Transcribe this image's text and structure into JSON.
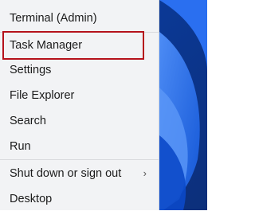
{
  "menu": {
    "items": [
      {
        "label": "Terminal (Admin)"
      },
      {
        "label": "Task Manager"
      },
      {
        "label": "Settings"
      },
      {
        "label": "File Explorer"
      },
      {
        "label": "Search"
      },
      {
        "label": "Run"
      },
      {
        "label": "Shut down or sign out",
        "submenu_indicator": "›"
      },
      {
        "label": "Desktop"
      }
    ]
  },
  "colors": {
    "menu_background": "#f2f3f5",
    "highlight_box": "#b5121b",
    "wallpaper_blue": "#1f5fd8"
  }
}
